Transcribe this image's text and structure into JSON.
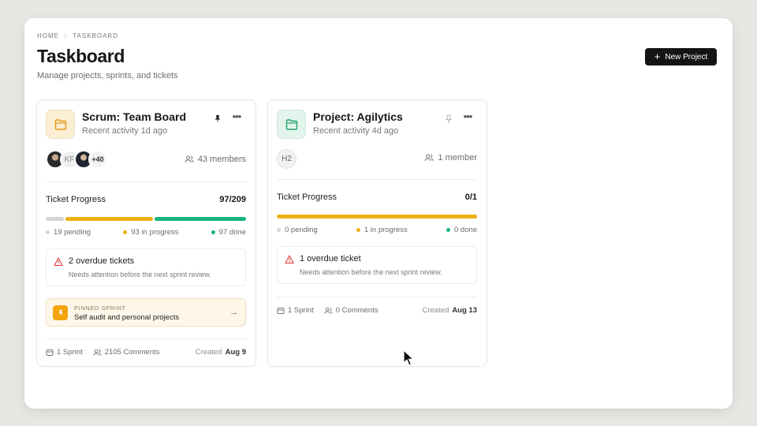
{
  "breadcrumb": [
    "HOME",
    "/",
    "TASKBOARD"
  ],
  "header": {
    "title": "Taskboard",
    "subtitle": "Manage projects, sprints, and tickets",
    "new_project_label": "New Project"
  },
  "cards": [
    {
      "title": "Scrum: Team Board",
      "activity": "Recent activity 1d ago",
      "pinned": true,
      "avatars": [
        "KF",
        "+40"
      ],
      "members": "43 members",
      "progress_label": "Ticket Progress",
      "progress_count": "97/209",
      "progress": {
        "pending": 19,
        "in_progress": 93,
        "done": 97,
        "total": 209
      },
      "legend": {
        "pending": "19 pending",
        "in_progress": "93 in progress",
        "done": "97 done"
      },
      "overdue_title": "2 overdue tickets",
      "overdue_desc": "Needs attention before the next sprint review.",
      "pinned_sprint_kicker": "PINNED SPRINT",
      "pinned_sprint_name": "Self audit and personal projects",
      "sprints": "1 Sprint",
      "comments": "2105 Comments",
      "created_label": "Created",
      "created_date": "Aug 9"
    },
    {
      "title": "Project: Agilytics",
      "activity": "Recent activity 4d ago",
      "pinned": false,
      "avatars": [
        "H2"
      ],
      "members": "1 member",
      "progress_label": "Ticket Progress",
      "progress_count": "0/1",
      "progress": {
        "pending": 0,
        "in_progress": 1,
        "done": 0,
        "total": 1
      },
      "legend": {
        "pending": "0 pending",
        "in_progress": "1 in progress",
        "done": "0 done"
      },
      "overdue_title": "1 overdue ticket",
      "overdue_desc": "Needs attention before the next sprint review.",
      "sprints": "1 Sprint",
      "comments": "0 Comments",
      "created_label": "Created",
      "created_date": "Aug 13"
    }
  ],
  "colors": {
    "pending": "#d4d4d4",
    "in_progress": "#edb015",
    "done": "#19b37d",
    "primary_button": "#141414"
  }
}
